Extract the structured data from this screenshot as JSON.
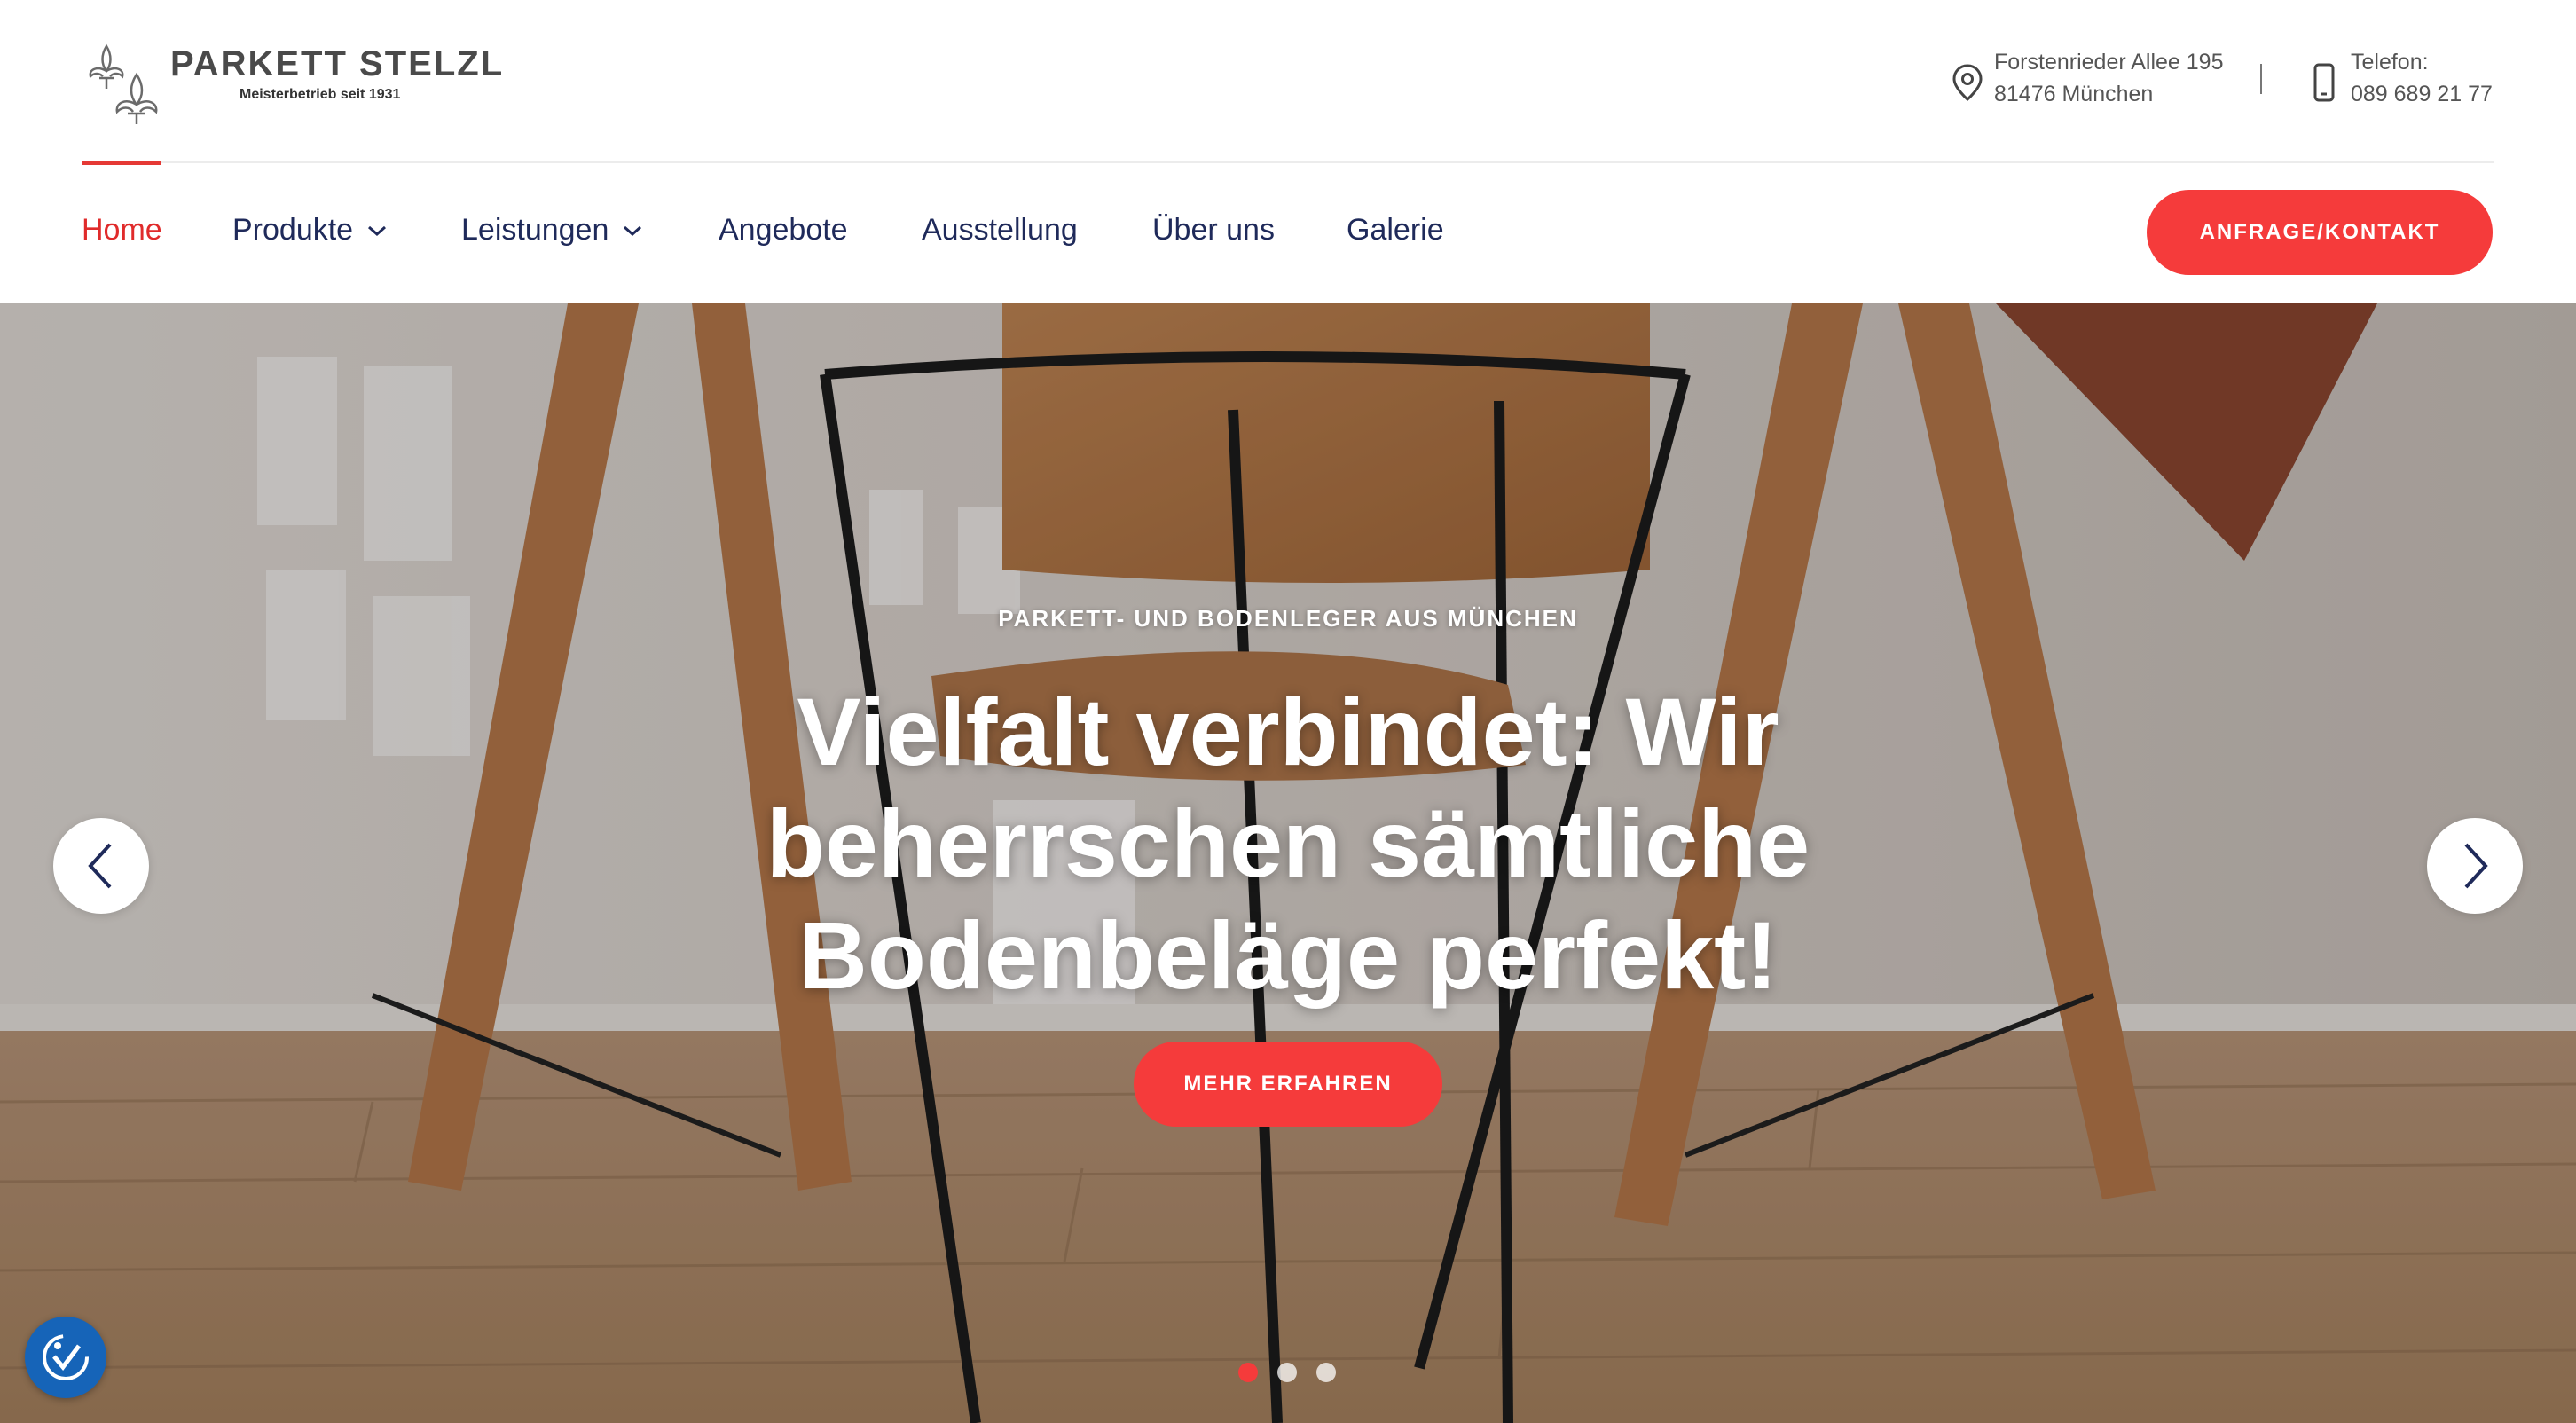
{
  "brand": {
    "name": "PARKETT STELZL",
    "tagline": "Meisterbetrieb seit 1931"
  },
  "contact": {
    "address_line1": "Forstenrieder Allee 195",
    "address_line2": "81476 München",
    "phone_label": "Telefon:",
    "phone_number": "089 689 21 77"
  },
  "nav": {
    "items": [
      {
        "label": "Home",
        "active": true
      },
      {
        "label": "Produkte",
        "has_dropdown": true
      },
      {
        "label": "Leistungen",
        "has_dropdown": true
      },
      {
        "label": "Angebote"
      },
      {
        "label": "Ausstellung"
      },
      {
        "label": "Über uns"
      },
      {
        "label": "Galerie"
      }
    ],
    "cta_label": "ANFRAGE/KONTAKT"
  },
  "hero": {
    "eyebrow": "PARKETT- UND BODENLEGER AUS MÜNCHEN",
    "headline": "Vielfalt verbindet: Wir beherrschen sämtliche Bodenbeläge perfekt!",
    "button_label": "MEHR ERFAHREN",
    "slide_count": 3,
    "active_slide": 1
  },
  "colors": {
    "accent": "#f53b3b",
    "nav_text": "#1f2a5a",
    "active_nav": "#e02b2b",
    "accessibility_button": "#1664b8"
  },
  "icons": {
    "location": "map-pin-icon",
    "phone": "smartphone-icon",
    "prev": "chevron-left-icon",
    "next": "chevron-right-icon",
    "dropdown": "chevron-down-icon",
    "accessibility": "accessibility-icon"
  }
}
